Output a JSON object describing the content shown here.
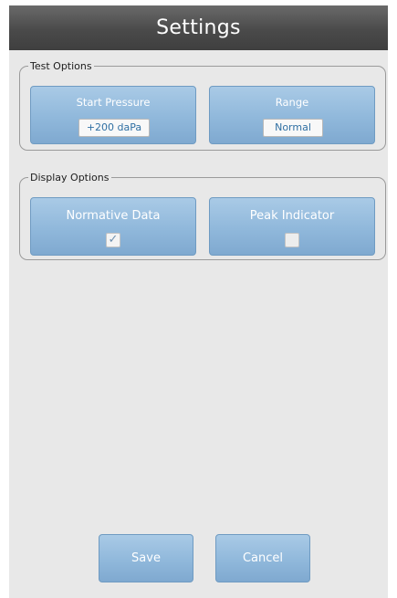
{
  "header": {
    "title": "Settings"
  },
  "test_options": {
    "legend": "Test Options",
    "start_pressure": {
      "label": "Start Pressure",
      "value": "+200 daPa"
    },
    "range": {
      "label": "Range",
      "value": "Normal"
    }
  },
  "display_options": {
    "legend": "Display Options",
    "normative_data": {
      "label": "Normative Data",
      "checked": true,
      "check_glyph": "✓"
    },
    "peak_indicator": {
      "label": "Peak Indicator",
      "checked": false
    }
  },
  "footer": {
    "save_label": "Save",
    "cancel_label": "Cancel"
  },
  "colors": {
    "title_bar": "#4a4a4a",
    "tile_blue": "#90b8db",
    "background": "#e8e8e8"
  }
}
